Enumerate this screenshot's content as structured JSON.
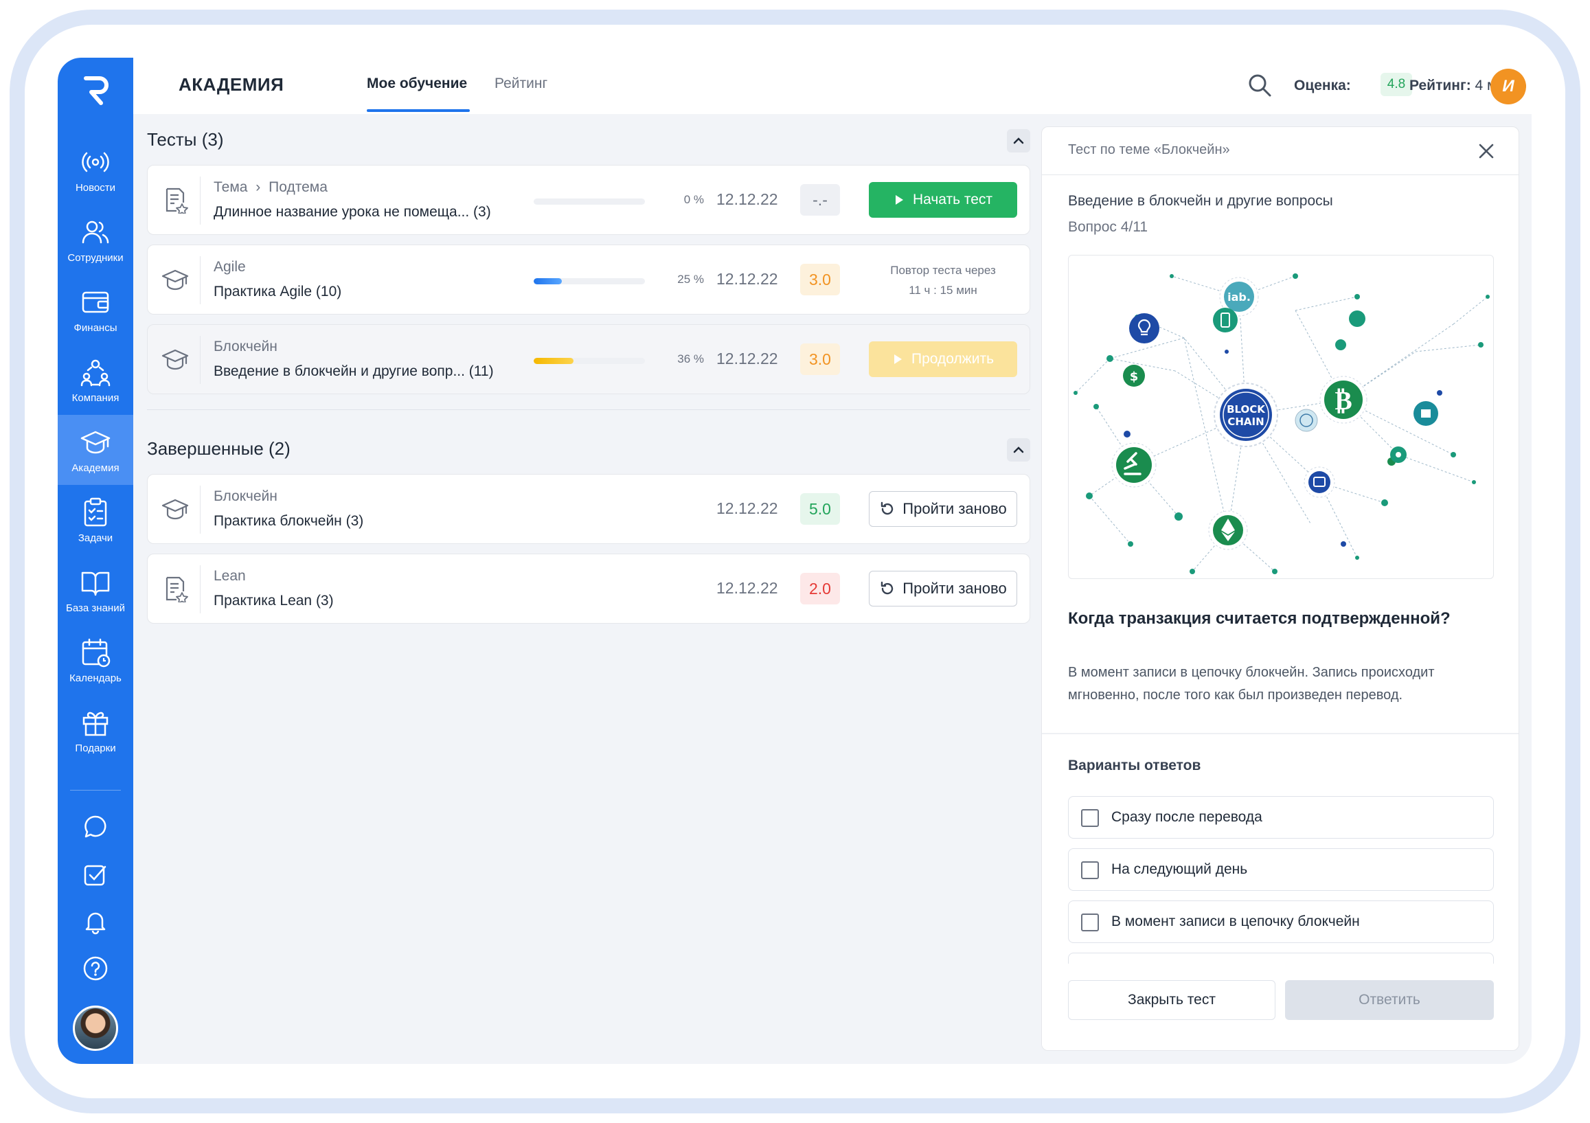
{
  "nav": {
    "items": [
      {
        "label": "Новости",
        "icon": "broadcast-icon"
      },
      {
        "label": "Сотрудники",
        "icon": "users-icon"
      },
      {
        "label": "Финансы",
        "icon": "wallet-icon"
      },
      {
        "label": "Компания",
        "icon": "company-icon"
      },
      {
        "label": "Академия",
        "icon": "graduation-cap-icon"
      },
      {
        "label": "Задачи",
        "icon": "clipboard-icon"
      },
      {
        "label": "База знаний",
        "icon": "book-icon"
      },
      {
        "label": "Календарь",
        "icon": "calendar-icon"
      },
      {
        "label": "Подарки",
        "icon": "gift-icon"
      }
    ],
    "active": "Академия",
    "bottom_icons": [
      "chat-icon",
      "checkbox-icon",
      "bell-icon",
      "help-icon"
    ]
  },
  "header": {
    "brand": "АКАДЕМИЯ",
    "tabs": [
      {
        "label": "Мое обучение"
      },
      {
        "label": "Рейтинг"
      }
    ],
    "score_label": "Оценка:",
    "score_value": "4.8",
    "rank_label": "Рейтинг:",
    "rank_value": "4 место",
    "user_initial": "И"
  },
  "tests": {
    "title": "Тесты (3)",
    "items": [
      {
        "category": "Тема",
        "subcategory": "Подтема",
        "title": "Длинное название урока не помеща... (3)",
        "progress_percent": 0,
        "progress_label": "0 %",
        "date": "12.12.22",
        "grade": "-.-",
        "action": "Начать тест"
      },
      {
        "category": "Agile",
        "title": "Практика Agile (10)",
        "progress_percent": 25,
        "progress_label": "25 %",
        "date": "12.12.22",
        "grade": "3.0",
        "retry_line1": "Повтор теста через",
        "retry_line2": "11 ч : 15 мин"
      },
      {
        "category": "Блокчейн",
        "title": "Введение в блокчейн и другие вопр... (11)",
        "progress_percent": 36,
        "progress_label": "36 %",
        "date": "12.12.22",
        "grade": "3.0",
        "action": "Продолжить"
      }
    ]
  },
  "completed": {
    "title": "Завершенные (2)",
    "items": [
      {
        "category": "Блокчейн",
        "title": "Практика блокчейн (3)",
        "date": "12.12.22",
        "grade": "5.0",
        "action": "Пройти заново"
      },
      {
        "category": "Lean",
        "title": "Практика Lean (3)",
        "date": "12.12.22",
        "grade": "2.0",
        "action": "Пройти заново"
      }
    ]
  },
  "panel": {
    "title": "Тест по теме «Блокчейн»",
    "subtitle": "Введение в блокчейн и другие вопросы",
    "question_counter": "Вопрос 4/11",
    "image": {
      "center_line1": "BLOCK",
      "center_line2": "CHAIN",
      "logo": "iab."
    },
    "question": "Когда транзакция считается подтвержденной?",
    "explanation": "В момент записи в цепочку блокчейн. Запись происходит мгновенно, после того как был произведен перевод.",
    "answers_title": "Варианты ответов",
    "answers": [
      "Сразу после перевода",
      "На следующий день",
      "В момент записи в цепочку блокчейн"
    ],
    "close_button": "Закрыть тест",
    "submit_button": "Ответить"
  },
  "colors": {
    "primary": "#1f74ec",
    "green": "#25b463",
    "yellow": "#f5c518",
    "red": "#e53935",
    "orange": "#f29322"
  }
}
